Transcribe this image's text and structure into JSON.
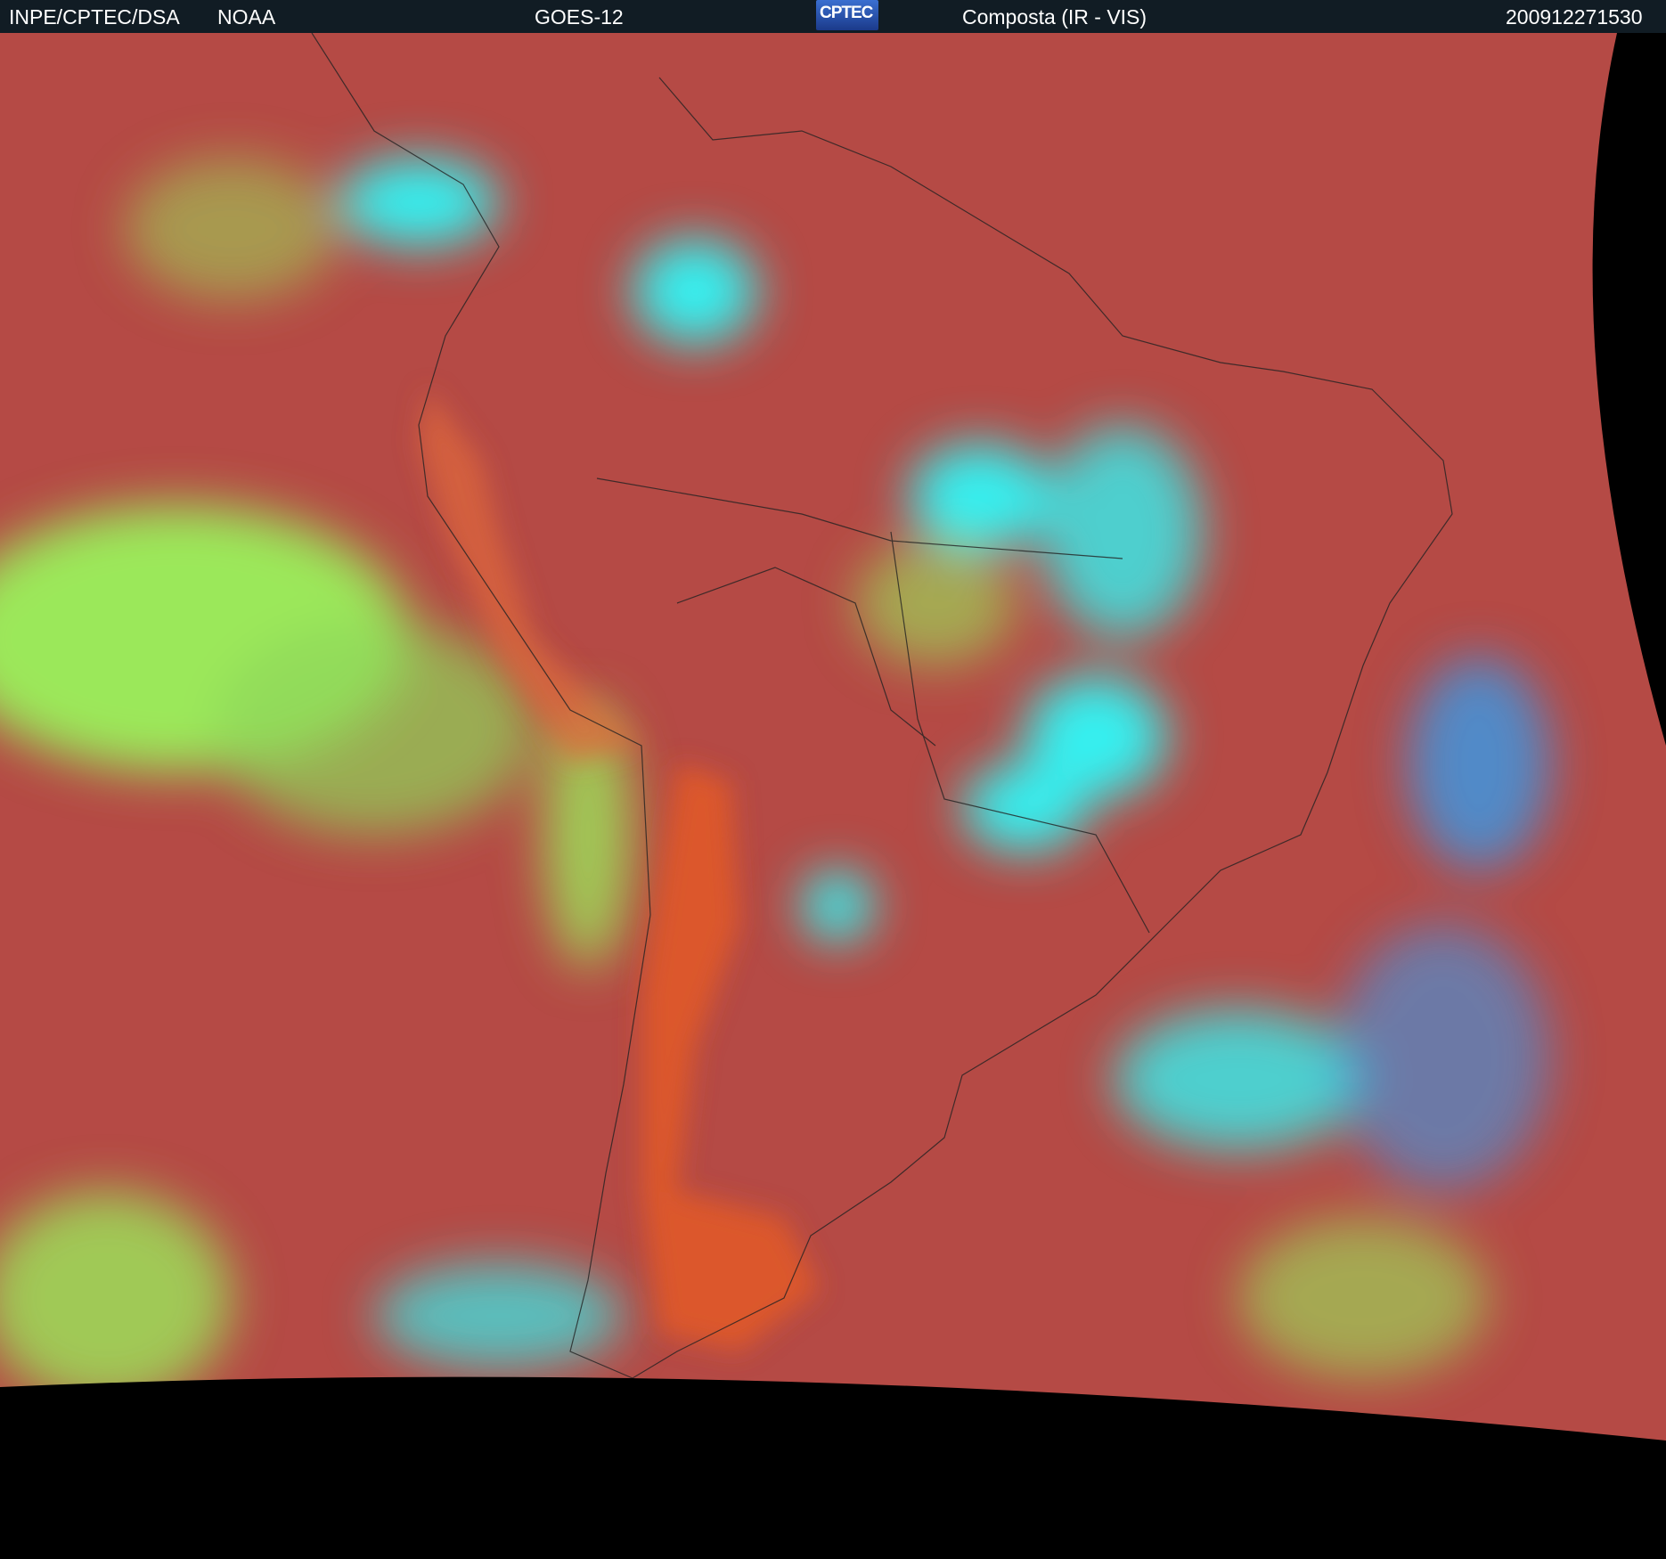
{
  "header": {
    "institution": "INPE/CPTEC/DSA",
    "agency": "NOAA",
    "satellite": "GOES-12",
    "logo_text": "CPTEC",
    "product": "Composta (IR - VIS)",
    "timestamp": "200912271530"
  },
  "colors": {
    "header_bg": "#111c24",
    "ocean_clear": "#b54a45",
    "land_warm": "#e05a2a",
    "low_cloud": "#9be85a",
    "high_cloud": "#35f0f0",
    "mid_cloud": "#3a9ae8",
    "space": "#000000"
  }
}
